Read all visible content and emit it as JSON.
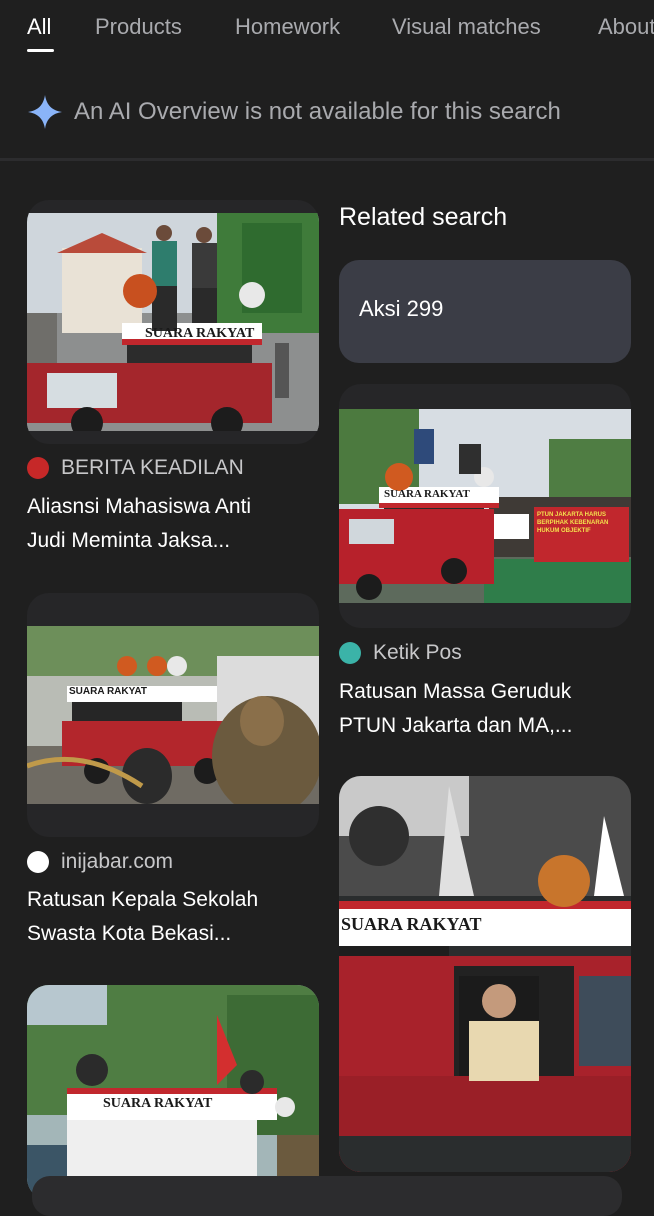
{
  "tabs": [
    {
      "label": "All",
      "active": true
    },
    {
      "label": "Products"
    },
    {
      "label": "Homework"
    },
    {
      "label": "Visual matches"
    },
    {
      "label": "About"
    }
  ],
  "ai_overview": {
    "icon": "sparkle-icon",
    "text": "An AI Overview is not available for this search"
  },
  "related_search": {
    "heading": "Related search",
    "chips": [
      "Aksi 299"
    ]
  },
  "results": [
    {
      "source": "BERITA KEADILAN",
      "source_icon": "berita-keadilan-logo-icon",
      "title_lines": [
        "Aliasnsi Mahasiswa Anti",
        "Judi Meminta Jaksa..."
      ],
      "image_sign": "SUARA RAKYAT"
    },
    {
      "source": "Ketik Pos",
      "source_icon": "ketik-pos-logo-icon",
      "title_lines": [
        "Ratusan Massa Geruduk",
        "PTUN Jakarta dan MA,..."
      ],
      "image_sign": "SUARA RAKYAT",
      "banner_text": "PTUN JAKARTA HARUS BERPIHAK KEBENARAN HUKUM OBJEKTIF"
    },
    {
      "source": "inijabar.com",
      "source_icon": "inijabar-logo-icon",
      "title_lines": [
        "Ratusan Kepala Sekolah",
        "Swasta Kota Bekasi..."
      ],
      "image_sign": "SUARA RAKYAT"
    },
    {
      "image_sign": "SUARA RAKYAT"
    },
    {
      "image_sign": "SUARA RAKYAT"
    }
  ],
  "colors": {
    "background": "#1f1f1f",
    "card": "#262628",
    "chip": "#3b3d46",
    "tab_inactive": "#a9aaae",
    "accent_sparkle": "#8ab4f8",
    "truck_red": "#b0232c"
  }
}
